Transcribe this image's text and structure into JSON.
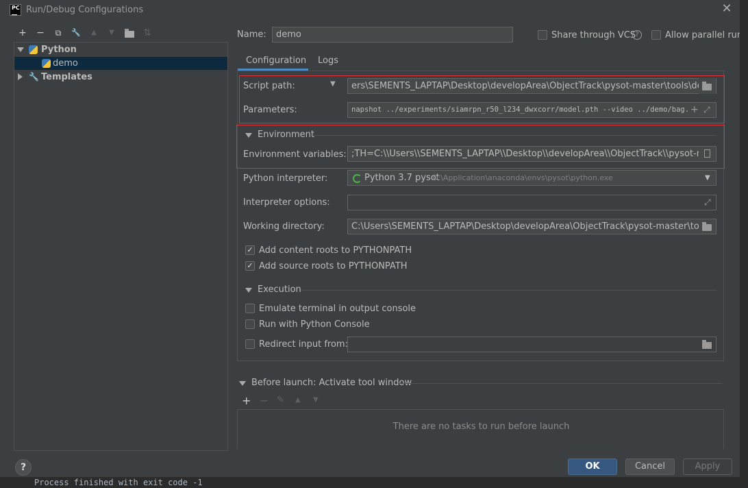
{
  "window": {
    "title": "Run/Debug Configurations",
    "app_icon_text": "PC"
  },
  "toolbar": {
    "add": "+",
    "remove": "−",
    "copy": "⧉",
    "edit": "🔧",
    "up": "▲",
    "down": "▼",
    "folder": "📁",
    "sort": "⇅"
  },
  "tree": {
    "python_label": "Python",
    "demo_label": "demo",
    "templates_label": "Templates"
  },
  "header": {
    "name_label": "Name:",
    "name_value": "demo",
    "share_vcs_label": "Share through VCS",
    "allow_parallel_label": "Allow parallel run"
  },
  "tabs": [
    {
      "label": "Configuration"
    },
    {
      "label": "Logs"
    }
  ],
  "config": {
    "script_path_label": "Script path:",
    "script_path_value": "ers\\SEMENTS_LAPTAP\\Desktop\\developArea\\ObjectTrack\\pysot-master\\tools\\demo.py",
    "parameters_label": "Parameters:",
    "parameters_value": "napshot ../experiments/siamrpn_r50_l234_dwxcorr/model.pth --video ../demo/bag.avi",
    "environment_section": "Environment",
    "env_vars_label": "Environment variables:",
    "env_vars_value": ";TH=C:\\\\Users\\\\SEMENTS_LAPTAP\\\\Desktop\\\\developArea\\\\ObjectTrack\\\\pysot-master",
    "interpreter_label": "Python interpreter:",
    "interpreter_name": "Python 3.7 pysot",
    "interpreter_path": "D:\\Application\\anaconda\\envs\\pysot\\python.exe",
    "interp_options_label": "Interpreter options:",
    "interp_options_value": "",
    "working_dir_label": "Working directory:",
    "working_dir_value": "C:\\Users\\SEMENTS_LAPTAP\\Desktop\\developArea\\ObjectTrack\\pysot-master\\tools",
    "content_roots_label": "Add content roots to PYTHONPATH",
    "source_roots_label": "Add source roots to PYTHONPATH",
    "execution_section": "Execution",
    "emulate_terminal_label": "Emulate terminal in output console",
    "python_console_label": "Run with Python Console",
    "redirect_input_label": "Redirect input from:",
    "redirect_input_value": ""
  },
  "before_launch": {
    "title": "Before launch: Activate tool window",
    "empty_text": "There are no tasks to run before launch"
  },
  "buttons": {
    "ok": "OK",
    "cancel": "Cancel",
    "apply": "Apply",
    "help": "?"
  },
  "background": {
    "console_text": "Process finished with exit code -1"
  },
  "colors": {
    "accent": "#4a88c7",
    "highlight_box": "#e0302f",
    "selection": "#0d293e"
  }
}
